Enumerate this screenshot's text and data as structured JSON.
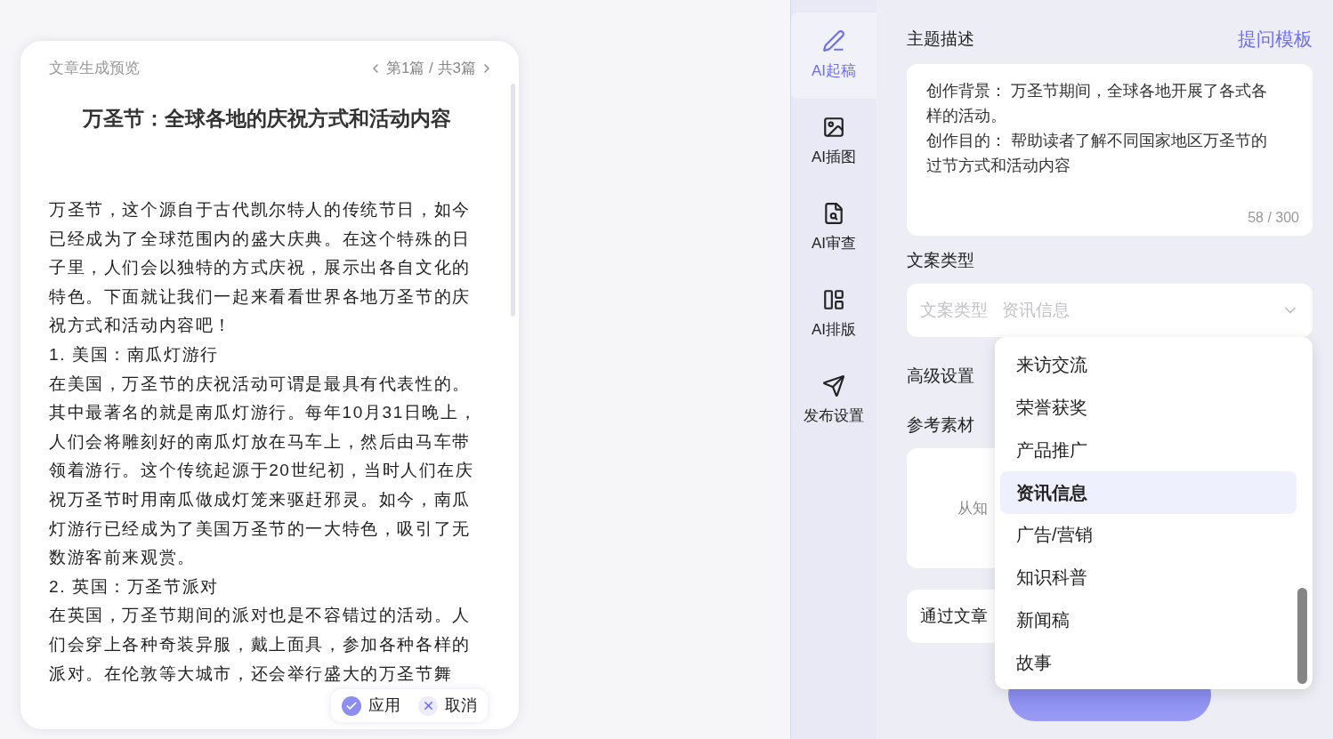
{
  "preview": {
    "title": "文章生成预览",
    "pager": "第1篇 / 共3篇",
    "article_title": "万圣节：全球各地的庆祝方式和活动内容",
    "paragraphs": [
      "万圣节，这个源自于古代凯尔特人的传统节日，如今已经成为了全球范围内的盛大庆典。在这个特殊的日子里，人们会以独特的方式庆祝，展示出各自文化的特色。下面就让我们一起来看看世界各地万圣节的庆祝方式和活动内容吧！",
      "1. 美国：南瓜灯游行",
      "在美国，万圣节的庆祝活动可谓是最具有代表性的。其中最著名的就是南瓜灯游行。每年10月31日晚上，人们会将雕刻好的南瓜灯放在马车上，然后由马车带领着游行。这个传统起源于20世纪初，当时人们在庆祝万圣节时用南瓜做成灯笼来驱赶邪灵。如今，南瓜灯游行已经成为了美国万圣节的一大特色，吸引了无数游客前来观赏。",
      "2. 英国：万圣节派对",
      "在英国，万圣节期间的派对也是不容错过的活动。人们会穿上各种奇装异服，戴上面具，参加各种各样的派对。在伦敦等大城市，还会举行盛大的万圣节舞"
    ],
    "actions": [
      {
        "label": "应用",
        "kind": "apply"
      },
      {
        "label": "取消",
        "kind": "cancel"
      }
    ]
  },
  "sidebar": {
    "items": [
      {
        "label": "AI起稿",
        "selected": true
      },
      {
        "label": "AI插图",
        "selected": false
      },
      {
        "label": "AI审查",
        "selected": false
      },
      {
        "label": "AI排版",
        "selected": false
      },
      {
        "label": "发布设置",
        "selected": false
      }
    ]
  },
  "form": {
    "topic": {
      "label": "主题描述",
      "link": "提问模板",
      "lines": [
        "创作背景： 万圣节期间，全球各地开展了各式各样的活动。",
        "创作目的： 帮助读者了解不同国家地区万圣节的过节方式和活动内容"
      ],
      "counter": "58 / 300"
    },
    "type": {
      "label": "文案类型",
      "field_label": "文案类型",
      "value": "资讯信息"
    },
    "advanced": {
      "label": "高级设置"
    },
    "reference": {
      "label": "参考素材",
      "hint": "从知"
    },
    "article_option": "通过文章"
  },
  "dropdown": {
    "items": [
      {
        "label": "来访交流",
        "selected": false
      },
      {
        "label": "荣誉获奖",
        "selected": false
      },
      {
        "label": "产品推广",
        "selected": false
      },
      {
        "label": "资讯信息",
        "selected": true
      },
      {
        "label": "广告/营销",
        "selected": false
      },
      {
        "label": "知识科普",
        "selected": false
      },
      {
        "label": "新闻稿",
        "selected": false
      },
      {
        "label": "故事",
        "selected": false
      }
    ]
  }
}
